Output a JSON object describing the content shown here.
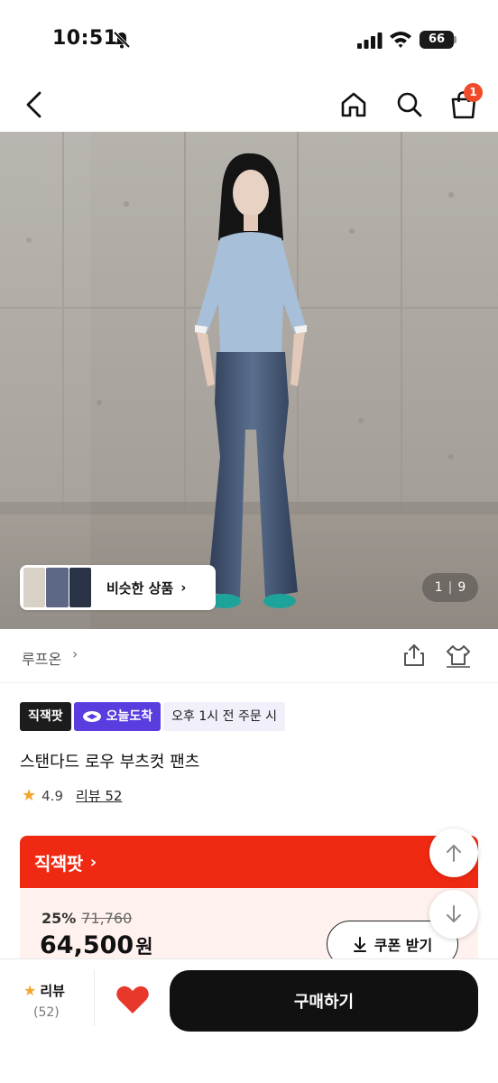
{
  "status_bar": {
    "time": "10:51",
    "battery": "66"
  },
  "nav": {
    "cart_count": "1"
  },
  "hero": {
    "similar_label": "비슷한 상품",
    "page_current": "1",
    "page_total": "9"
  },
  "brand": {
    "name": "루프온"
  },
  "badges": {
    "direct": "직잭팟",
    "today": "오늘도착",
    "order_time": "오후 1시 전 주문 시"
  },
  "product": {
    "title": "스탠다드 로우 부츠컷 팬츠",
    "rating": "4.9",
    "review_label": "리뷰 52"
  },
  "promo": {
    "title": "직잭팟",
    "discount_rate": "25%",
    "original_price": "71,760",
    "sale_price": "64,500",
    "currency": "원",
    "coupon_label": "쿠폰 받기"
  },
  "bottom": {
    "review_label": "리뷰",
    "review_count": "(52)",
    "buy_label": "구매하기"
  },
  "colors": {
    "accent_red": "#f02a12",
    "badge_purple": "#5b3cdf",
    "heart_red": "#e8382b",
    "star": "#f2a52b"
  },
  "icons": [
    "mute-icon",
    "signal-icon",
    "wifi-icon",
    "back-icon",
    "home-icon",
    "search-icon",
    "cart-icon",
    "share-icon",
    "fit-icon",
    "heart-icon",
    "arrow-up-icon",
    "arrow-down-icon",
    "download-icon",
    "star-icon"
  ]
}
